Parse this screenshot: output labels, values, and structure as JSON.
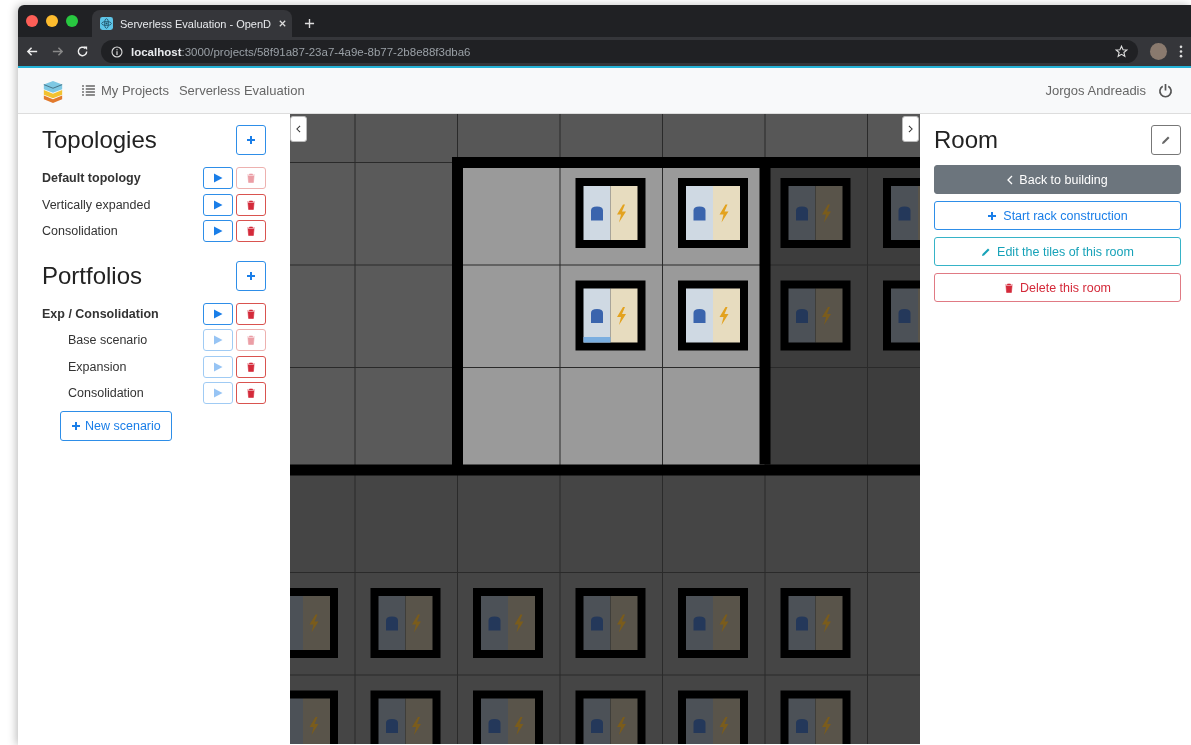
{
  "browser": {
    "tab_title": "Serverless Evaluation - OpenD",
    "url": "**localhost**:3000/projects/58f91a87-23a7-4a9e-8b77-2b8e88f3dba6"
  },
  "navbar": {
    "breadcrumbs": [
      "My Projects",
      "Serverless Evaluation"
    ],
    "user": "Jorgos Andreadis"
  },
  "sidebar": {
    "topologies": {
      "title": "Topologies",
      "items": [
        {
          "label": "Default topology",
          "selected": true,
          "delete_disabled": true
        },
        {
          "label": "Vertically expanded",
          "selected": false,
          "delete_disabled": false
        },
        {
          "label": "Consolidation",
          "selected": false,
          "delete_disabled": false
        }
      ]
    },
    "portfolios": {
      "title": "Portfolios",
      "items": [
        {
          "label": "Exp / Consolidation",
          "selected": true,
          "delete_disabled": false,
          "children": [
            {
              "label": "Base scenario",
              "run_disabled": true,
              "delete_disabled": true
            },
            {
              "label": "Expansion",
              "run_disabled": true,
              "delete_disabled": false
            },
            {
              "label": "Consolidation",
              "run_disabled": true,
              "delete_disabled": false
            }
          ]
        }
      ]
    },
    "new_scenario": "New scenario"
  },
  "room_panel": {
    "title": "Room",
    "buttons": [
      {
        "label": "Back to building",
        "kind": "back"
      },
      {
        "label": "Start rack construction",
        "kind": "add"
      },
      {
        "label": "Edit the tiles of this room",
        "kind": "edit"
      },
      {
        "label": "Delete this room",
        "kind": "delete"
      }
    ]
  }
}
